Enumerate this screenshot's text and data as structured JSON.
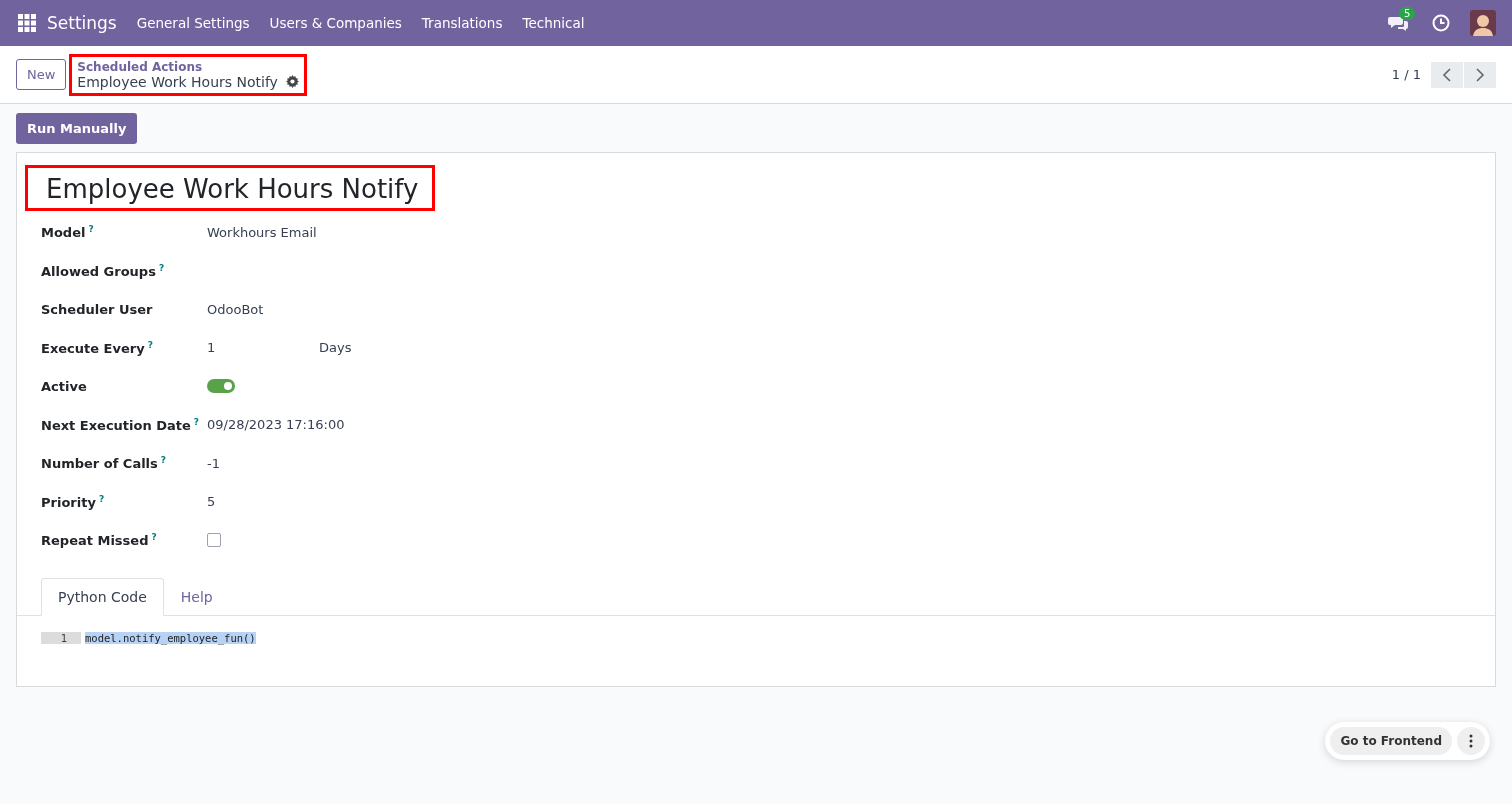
{
  "navbar": {
    "app_name": "Settings",
    "menus": [
      "General Settings",
      "Users & Companies",
      "Translations",
      "Technical"
    ],
    "chat_badge": "5"
  },
  "control_panel": {
    "new_button": "New",
    "breadcrumb_parent": "Scheduled Actions",
    "breadcrumb_current": "Employee Work Hours Notify",
    "pager": "1 / 1",
    "highlighted": true
  },
  "actions": {
    "run_button": "Run Manually"
  },
  "form": {
    "title": "Employee Work Hours Notify",
    "title_highlighted": true,
    "fields": [
      {
        "kind": "text",
        "label": "Model",
        "tooltip": "?",
        "value": "Workhours Email"
      },
      {
        "kind": "text",
        "label": "Allowed Groups",
        "tooltip": "?"
      },
      {
        "kind": "text",
        "label": "Scheduler User",
        "value": "OdooBot"
      },
      {
        "kind": "interval",
        "label": "Execute Every",
        "tooltip": "?",
        "value": "1",
        "unit": "Days"
      },
      {
        "kind": "toggle",
        "label": "Active",
        "on": true
      },
      {
        "kind": "text",
        "label": "Next Execution Date",
        "tooltip": "?",
        "value": "09/28/2023 17:16:00"
      },
      {
        "kind": "text",
        "label": "Number of Calls",
        "tooltip": "?",
        "value": "-1"
      },
      {
        "kind": "text",
        "label": "Priority",
        "tooltip": "?",
        "value": "5"
      },
      {
        "kind": "checkbox",
        "label": "Repeat Missed",
        "tooltip": "?",
        "checked": false
      }
    ],
    "tabs": [
      {
        "label": "Python Code",
        "selected": true
      },
      {
        "label": "Help",
        "selected": false
      }
    ],
    "code_lines": [
      {
        "number": "1",
        "text": "model.notify_employee_fun()",
        "selected": true
      }
    ]
  },
  "floating": {
    "frontend_button": "Go to Frontend"
  }
}
